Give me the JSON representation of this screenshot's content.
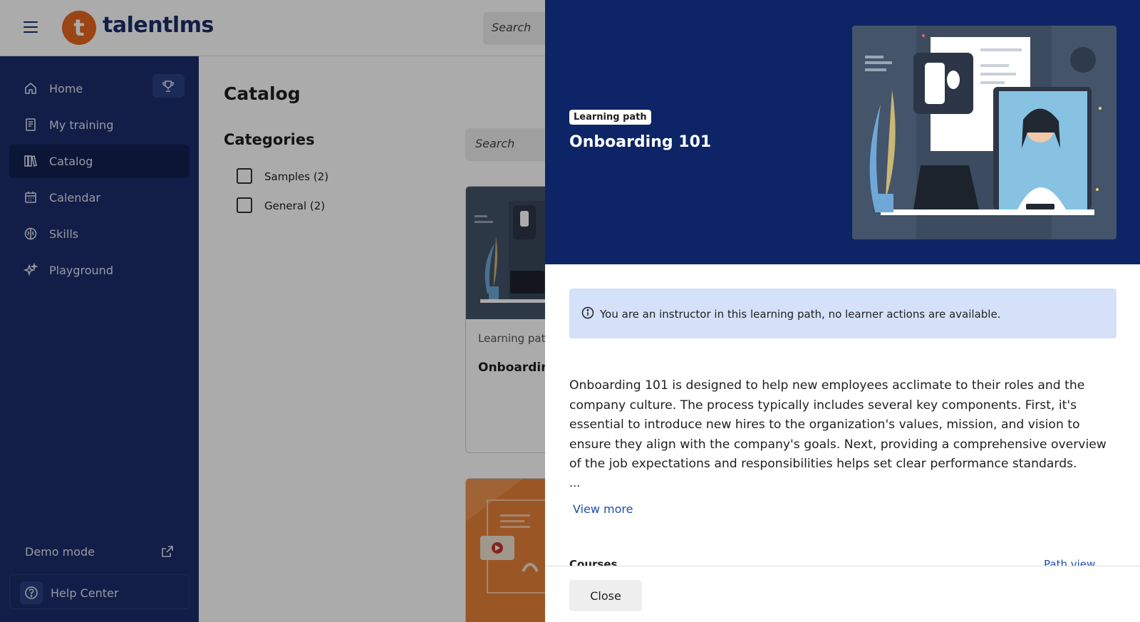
{
  "brand": {
    "logo_letter": "t",
    "name": "talentlms",
    "accent": "#e8661f",
    "primary": "#1b2d6b"
  },
  "topbar": {
    "search_placeholder": "Search"
  },
  "sidebar": {
    "items": [
      {
        "label": "Home",
        "icon": "home-icon",
        "active": false
      },
      {
        "label": "My training",
        "icon": "book-icon",
        "active": false
      },
      {
        "label": "Catalog",
        "icon": "library-icon",
        "active": true
      },
      {
        "label": "Calendar",
        "icon": "calendar-icon",
        "active": false
      },
      {
        "label": "Skills",
        "icon": "brain-icon",
        "active": false
      },
      {
        "label": "Playground",
        "icon": "sparkle-icon",
        "active": false
      }
    ],
    "trophy_icon": "trophy-icon",
    "demo_mode": "Demo mode",
    "help_center": "Help Center"
  },
  "main": {
    "title": "Catalog",
    "categories_title": "Categories",
    "categories": [
      {
        "label": "Samples (2)",
        "checked": false
      },
      {
        "label": "General (2)",
        "checked": false
      }
    ],
    "search_placeholder": "Search",
    "cards": [
      {
        "type": "Learning pat",
        "title": "Onboarding"
      },
      {
        "type": "",
        "title": ""
      }
    ]
  },
  "drawer": {
    "badge": "Learning path",
    "title": "Onboarding 101",
    "info": "You are an instructor in this learning path, no learner actions are available.",
    "description": "Onboarding 101 is designed to help new employees acclimate to their roles and the company culture. The process typically includes several key components. First, it's essential to introduce new hires to the organization's values, mission, and vision to ensure they align with the company's goals. Next, providing a comprehensive overview of the job expectations and responsibilities helps set clear performance standards.",
    "ellipsis": "...",
    "view_more": "View more",
    "courses_label": "Courses",
    "path_view": "Path view",
    "close_label": "Close",
    "hero_bg": "#0d2566",
    "info_bg": "#d4e1f9"
  }
}
